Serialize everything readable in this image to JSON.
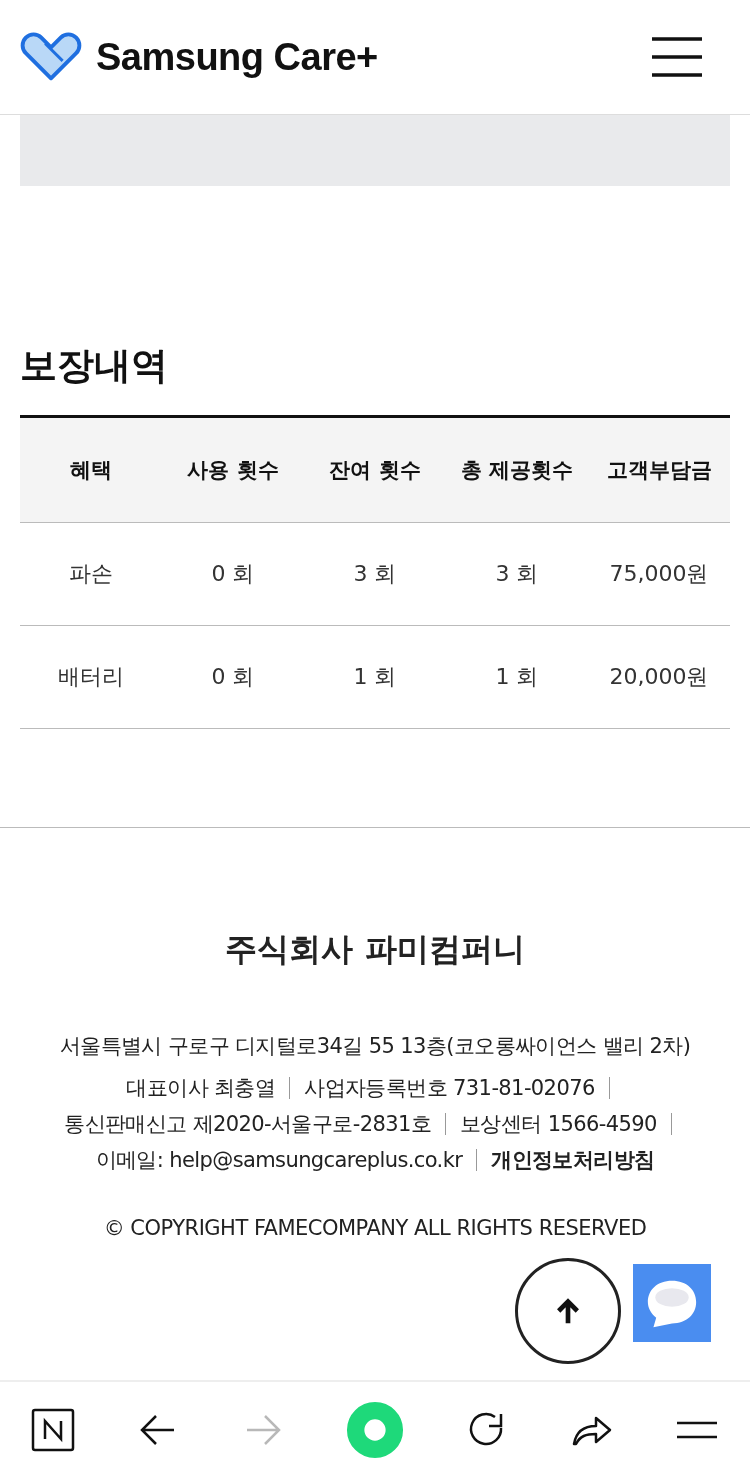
{
  "header": {
    "brand": "Samsung Care+"
  },
  "section": {
    "title": "보장내역"
  },
  "table": {
    "columns": [
      "혜택",
      "사용 횟수",
      "잔여 횟수",
      "총 제공횟수",
      "고객부담금"
    ],
    "rows": [
      [
        "파손",
        "0 회",
        "3 회",
        "3 회",
        "75,000원"
      ],
      [
        "배터리",
        "0 회",
        "1 회",
        "1 회",
        "20,000원"
      ]
    ]
  },
  "footer": {
    "company": "주식회사 파미컴퍼니",
    "address": "서울특별시 구로구 디지털로34길 55 13층(코오롱싸이언스 밸리 2차)",
    "info_rows": [
      [
        {
          "kind": "text",
          "text": "대표이사 최충열"
        },
        {
          "kind": "text",
          "text": "사업자등록번호 731-81-02076"
        }
      ],
      [
        {
          "kind": "text",
          "text": "통신판매신고 제2020-서울구로-2831호"
        },
        {
          "kind": "text",
          "text": "보상센터 1566-4590"
        }
      ],
      [
        {
          "kind": "text",
          "text": "이메일: help@samsungcareplus.co.kr"
        },
        {
          "kind": "link",
          "text": "개인정보처리방침"
        }
      ]
    ],
    "copyright": "© COPYRIGHT FAMECOMPANY ALL RIGHTS RESERVED"
  },
  "browser_bar": {
    "forward_disabled": true
  }
}
